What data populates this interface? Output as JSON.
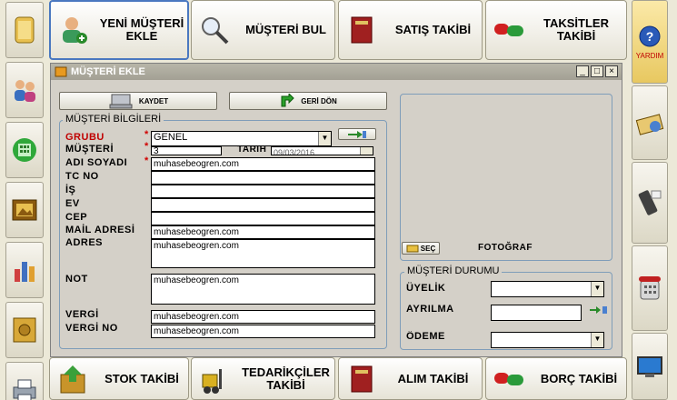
{
  "nav": {
    "top": [
      {
        "label": "YENİ MÜŞTERİ EKLE",
        "icon": "new-customer-icon"
      },
      {
        "label": "MÜŞTERİ BUL",
        "icon": "magnifier-icon"
      },
      {
        "label": "SATIŞ TAKİBİ",
        "icon": "book-icon"
      },
      {
        "label": "TAKSİTLER TAKİBİ",
        "icon": "pills-icon"
      }
    ],
    "bottom": [
      {
        "label": "STOK TAKİBİ",
        "icon": "stock-box-icon"
      },
      {
        "label": "TEDARİKÇİLER TAKİBİ",
        "icon": "forklift-icon"
      },
      {
        "label": "ALIM TAKİBİ",
        "icon": "book-icon"
      },
      {
        "label": "BORÇ TAKİBİ",
        "icon": "pills-icon"
      }
    ]
  },
  "right": {
    "help_label": "YARDIM"
  },
  "window": {
    "title": "MÜŞTERİ EKLE",
    "save_label": "KAYDET",
    "back_label": "GERİ DÖN",
    "customer_info_legend": "MÜŞTERİ BİLGİLERİ",
    "fields": {
      "grubu_label": "GRUBU",
      "grubu_value": "GENEL",
      "musteri_label": "MÜŞTERİ",
      "musteri_value": "3",
      "tarih_label": "TARİH",
      "tarih_value": "09/03/2016",
      "adsoyadi_label": "ADI SOYADI",
      "adsoyadi_value": "muhasebeogren.com",
      "tcno_label": "TC NO",
      "is_label": "İŞ",
      "ev_label": "EV",
      "cep_label": "CEP",
      "mail_label": "MAİL ADRESİ",
      "mail_value": "muhasebeogren.com",
      "adres_label": "ADRES",
      "adres_value": "muhasebeogren.com",
      "not_label": "NOT",
      "not_value": "muhasebeogren.com",
      "vergi_label": "VERGİ",
      "vergi_value": "muhasebeogren.com",
      "vergino_label": "VERGİ NO",
      "vergino_value": "muhasebeogren.com"
    },
    "photo": {
      "select_label": "SEÇ",
      "caption": "FOTOĞRAF"
    },
    "status": {
      "legend": "MÜŞTERİ DURUMU",
      "uyelik_label": "ÜYELİK",
      "ayrilma_label": "AYRILMA",
      "odeme_label": "ÖDEME"
    }
  }
}
